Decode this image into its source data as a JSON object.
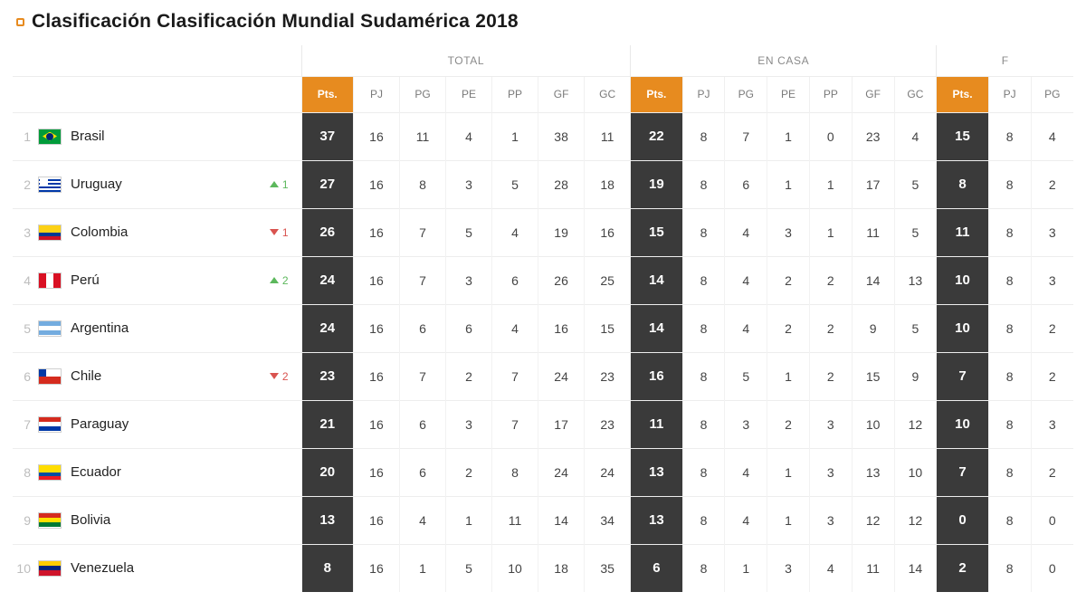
{
  "title": "Clasificación Clasificación Mundial Sudamérica 2018",
  "groups": {
    "total": "TOTAL",
    "home": "EN CASA",
    "away_partial": "F"
  },
  "columns": {
    "pts": "Pts.",
    "pj": "PJ",
    "pg": "PG",
    "pe": "PE",
    "pp": "PP",
    "gf": "GF",
    "gc": "GC"
  },
  "chart_data": {
    "type": "table",
    "title": "Clasificación Clasificación Mundial Sudamérica 2018",
    "rows": [
      {
        "rank": 1,
        "team": "Brasil",
        "flag": "brasil",
        "move": null,
        "total": {
          "pts": 37,
          "pj": 16,
          "pg": 11,
          "pe": 4,
          "pp": 1,
          "gf": 38,
          "gc": 11
        },
        "home": {
          "pts": 22,
          "pj": 8,
          "pg": 7,
          "pe": 1,
          "pp": 0,
          "gf": 23,
          "gc": 4
        },
        "away": {
          "pts": 15,
          "pj": 8,
          "pg": 4
        }
      },
      {
        "rank": 2,
        "team": "Uruguay",
        "flag": "uruguay",
        "move": {
          "dir": "up",
          "n": 1
        },
        "total": {
          "pts": 27,
          "pj": 16,
          "pg": 8,
          "pe": 3,
          "pp": 5,
          "gf": 28,
          "gc": 18
        },
        "home": {
          "pts": 19,
          "pj": 8,
          "pg": 6,
          "pe": 1,
          "pp": 1,
          "gf": 17,
          "gc": 5
        },
        "away": {
          "pts": 8,
          "pj": 8,
          "pg": 2
        }
      },
      {
        "rank": 3,
        "team": "Colombia",
        "flag": "colombia",
        "move": {
          "dir": "down",
          "n": 1
        },
        "total": {
          "pts": 26,
          "pj": 16,
          "pg": 7,
          "pe": 5,
          "pp": 4,
          "gf": 19,
          "gc": 16
        },
        "home": {
          "pts": 15,
          "pj": 8,
          "pg": 4,
          "pe": 3,
          "pp": 1,
          "gf": 11,
          "gc": 5
        },
        "away": {
          "pts": 11,
          "pj": 8,
          "pg": 3
        }
      },
      {
        "rank": 4,
        "team": "Perú",
        "flag": "peru",
        "move": {
          "dir": "up",
          "n": 2
        },
        "total": {
          "pts": 24,
          "pj": 16,
          "pg": 7,
          "pe": 3,
          "pp": 6,
          "gf": 26,
          "gc": 25
        },
        "home": {
          "pts": 14,
          "pj": 8,
          "pg": 4,
          "pe": 2,
          "pp": 2,
          "gf": 14,
          "gc": 13
        },
        "away": {
          "pts": 10,
          "pj": 8,
          "pg": 3
        }
      },
      {
        "rank": 5,
        "team": "Argentina",
        "flag": "argentina",
        "move": null,
        "total": {
          "pts": 24,
          "pj": 16,
          "pg": 6,
          "pe": 6,
          "pp": 4,
          "gf": 16,
          "gc": 15
        },
        "home": {
          "pts": 14,
          "pj": 8,
          "pg": 4,
          "pe": 2,
          "pp": 2,
          "gf": 9,
          "gc": 5
        },
        "away": {
          "pts": 10,
          "pj": 8,
          "pg": 2
        }
      },
      {
        "rank": 6,
        "team": "Chile",
        "flag": "chile",
        "move": {
          "dir": "down",
          "n": 2
        },
        "total": {
          "pts": 23,
          "pj": 16,
          "pg": 7,
          "pe": 2,
          "pp": 7,
          "gf": 24,
          "gc": 23
        },
        "home": {
          "pts": 16,
          "pj": 8,
          "pg": 5,
          "pe": 1,
          "pp": 2,
          "gf": 15,
          "gc": 9
        },
        "away": {
          "pts": 7,
          "pj": 8,
          "pg": 2
        }
      },
      {
        "rank": 7,
        "team": "Paraguay",
        "flag": "paraguay",
        "move": null,
        "total": {
          "pts": 21,
          "pj": 16,
          "pg": 6,
          "pe": 3,
          "pp": 7,
          "gf": 17,
          "gc": 23
        },
        "home": {
          "pts": 11,
          "pj": 8,
          "pg": 3,
          "pe": 2,
          "pp": 3,
          "gf": 10,
          "gc": 12
        },
        "away": {
          "pts": 10,
          "pj": 8,
          "pg": 3
        }
      },
      {
        "rank": 8,
        "team": "Ecuador",
        "flag": "ecuador",
        "move": null,
        "total": {
          "pts": 20,
          "pj": 16,
          "pg": 6,
          "pe": 2,
          "pp": 8,
          "gf": 24,
          "gc": 24
        },
        "home": {
          "pts": 13,
          "pj": 8,
          "pg": 4,
          "pe": 1,
          "pp": 3,
          "gf": 13,
          "gc": 10
        },
        "away": {
          "pts": 7,
          "pj": 8,
          "pg": 2
        }
      },
      {
        "rank": 9,
        "team": "Bolivia",
        "flag": "bolivia",
        "move": null,
        "total": {
          "pts": 13,
          "pj": 16,
          "pg": 4,
          "pe": 1,
          "pp": 11,
          "gf": 14,
          "gc": 34
        },
        "home": {
          "pts": 13,
          "pj": 8,
          "pg": 4,
          "pe": 1,
          "pp": 3,
          "gf": 12,
          "gc": 12
        },
        "away": {
          "pts": 0,
          "pj": 8,
          "pg": 0
        }
      },
      {
        "rank": 10,
        "team": "Venezuela",
        "flag": "venezuela",
        "move": null,
        "total": {
          "pts": 8,
          "pj": 16,
          "pg": 1,
          "pe": 5,
          "pp": 10,
          "gf": 18,
          "gc": 35
        },
        "home": {
          "pts": 6,
          "pj": 8,
          "pg": 1,
          "pe": 3,
          "pp": 4,
          "gf": 11,
          "gc": 14
        },
        "away": {
          "pts": 2,
          "pj": 8,
          "pg": 0
        }
      }
    ]
  }
}
